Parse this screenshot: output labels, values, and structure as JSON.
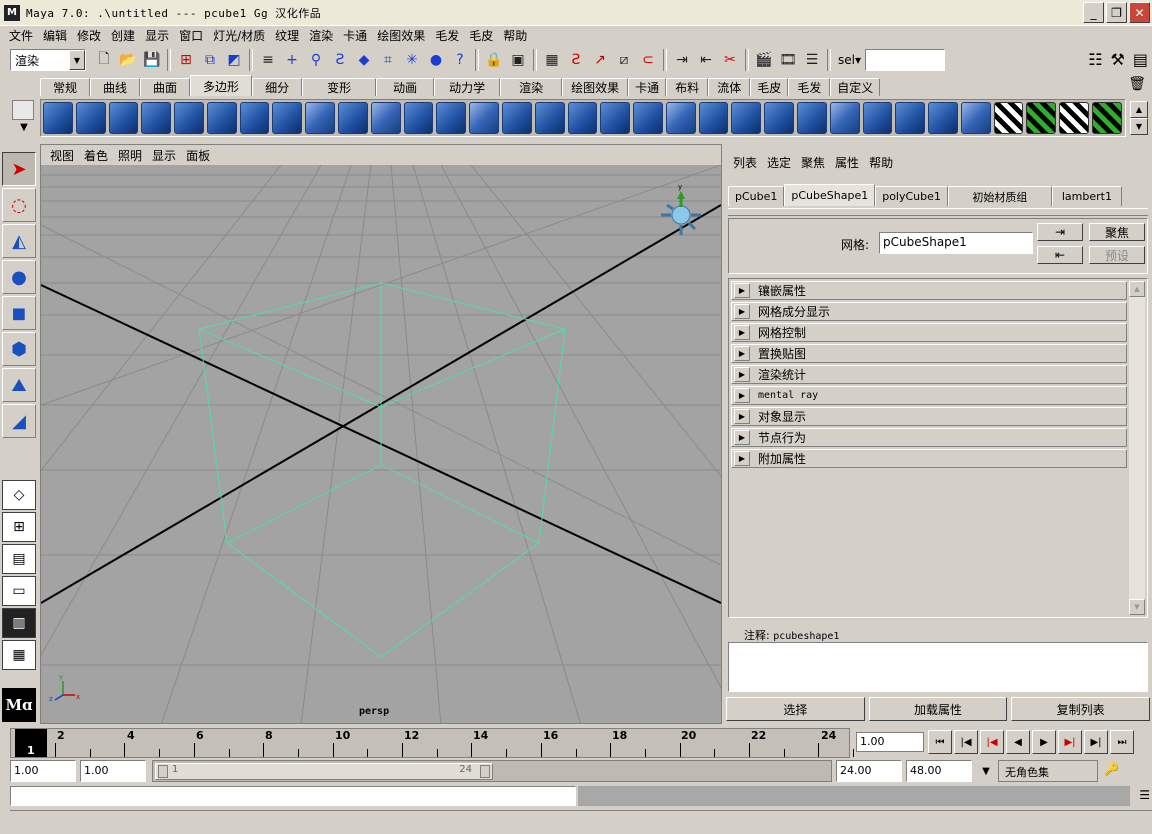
{
  "window": {
    "title": "Maya 7.0: .\\untitled   ---   pcube1   Gg 汉化作品",
    "minimize": "_",
    "maximize": "❐",
    "close": "✕"
  },
  "menubar": [
    "文件",
    "编辑",
    "修改",
    "创建",
    "显示",
    "窗口",
    "灯光/材质",
    "纹理",
    "渲染",
    "卡通",
    "绘图效果",
    "毛发",
    "毛皮",
    "帮助"
  ],
  "statusline": {
    "menu_set": "渲染",
    "sel_label": "sel▾",
    "sel_value": ""
  },
  "shelf_tabs": [
    "常规",
    "曲线",
    "曲面",
    "多边形",
    "细分",
    "变形",
    "动画",
    "动力学",
    "渲染",
    "绘图效果",
    "卡通",
    "布料",
    "流体",
    "毛皮",
    "毛发",
    "自定义"
  ],
  "shelf_active_tab": "多边形",
  "viewport": {
    "menu": [
      "视图",
      "着色",
      "照明",
      "显示",
      "面板"
    ],
    "camera_label": "persp",
    "wire_color": "#4fe0a0",
    "bg_color": "#a3a3a3"
  },
  "attribute_editor": {
    "menu": [
      "列表",
      "选定",
      "聚焦",
      "属性",
      "帮助"
    ],
    "node_tabs": [
      "pCube1",
      "pCubeShape1",
      "polyCube1",
      "初始材质组",
      "lambert1"
    ],
    "active_node_tab": "pCubeShape1",
    "mesh_label": "网格:",
    "mesh_value": "pCubeShape1",
    "focus_button": "聚焦",
    "presets_button": "预设",
    "sections": [
      "镶嵌属性",
      "网格成分显示",
      "网格控制",
      "置换贴图",
      "渲染统计",
      "mental ray",
      "对象显示",
      "节点行为",
      "附加属性"
    ],
    "notes_label": "注释:",
    "notes_node": "pcubeshape1",
    "buttons": [
      "选择",
      "加载属性",
      "复制列表"
    ]
  },
  "timeslider": {
    "current_frame": "1",
    "tick_labels": [
      "2",
      "4",
      "6",
      "8",
      "10",
      "12",
      "14",
      "16",
      "18",
      "20",
      "22",
      "24"
    ],
    "current_time": "1.00"
  },
  "range": {
    "start_time": "1.00",
    "playback_start": "1.00",
    "range_start_label": "1",
    "range_end_label": "24",
    "playback_end": "24.00",
    "end_time": "48.00",
    "character_set": "无角色集"
  }
}
